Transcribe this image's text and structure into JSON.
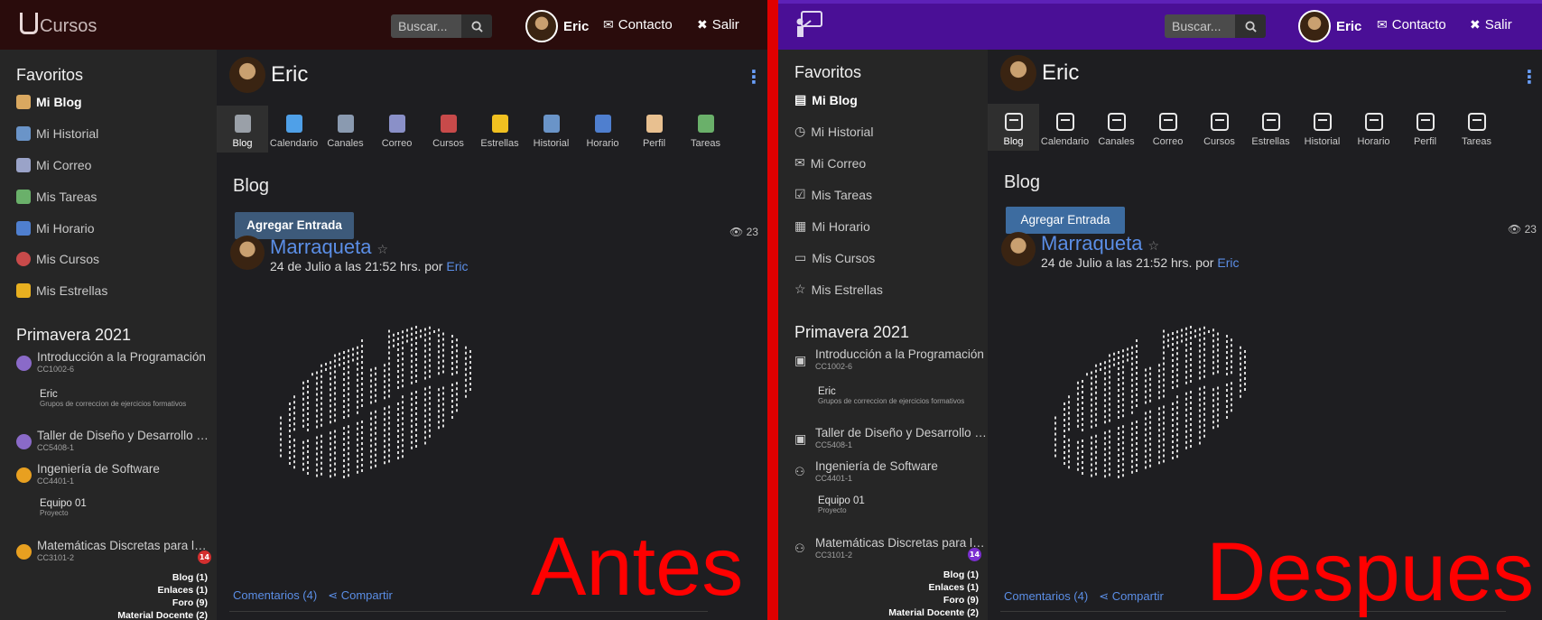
{
  "before": {
    "logo_text": "Cursos",
    "search_placeholder": "Buscar...",
    "user": "Eric",
    "contact": "Contacto",
    "logout": "Salir",
    "favorites_title": "Favoritos",
    "favorites": [
      "Mi Blog",
      "Mi Historial",
      "Mi Correo",
      "Mis Tareas",
      "Mi Horario",
      "Mis Cursos",
      "Mis Estrellas"
    ],
    "semester": "Primavera 2021",
    "courses": [
      {
        "name": "Introducción a la Programación",
        "code": "CC1002-6"
      },
      {
        "name": "Taller de Diseño y Desarrollo de Interfaces",
        "code": "CC5408-1"
      },
      {
        "name": "Ingeniería de Software",
        "code": "CC4401-1"
      },
      {
        "name": "Matemáticas Discretas para la Computación",
        "code": "CC3101-2"
      }
    ],
    "group1": {
      "name": "Eric",
      "desc": "Grupos de correccion de ejercicios formativos"
    },
    "group2": {
      "name": "Equipo 01",
      "desc": "Proyecto"
    },
    "badge": "14",
    "sublinks": [
      "Blog (1)",
      "Enlaces (1)",
      "Foro (9)",
      "Material Docente (2)"
    ],
    "page_title": "Eric",
    "tabs": [
      "Blog",
      "Calendario",
      "Canales",
      "Correo",
      "Cursos",
      "Estrellas",
      "Historial",
      "Horario",
      "Perfil",
      "Tareas"
    ],
    "section": "Blog",
    "add_button": "Agregar Entrada",
    "views": "23",
    "post_title": "Marraqueta",
    "post_meta": "24 de Julio a las 21:52 hrs. por",
    "post_author": "Eric",
    "comments": "Comentarios (4)",
    "share": "Compartir",
    "label": "Antes"
  },
  "after": {
    "search_placeholder": "Buscar...",
    "user": "Eric",
    "contact": "Contacto",
    "logout": "Salir",
    "favorites_title": "Favoritos",
    "favorites": [
      "Mi Blog",
      "Mi Historial",
      "Mi Correo",
      "Mis Tareas",
      "Mi Horario",
      "Mis Cursos",
      "Mis Estrellas"
    ],
    "semester": "Primavera 2021",
    "courses": [
      {
        "name": "Introducción a la Programación",
        "code": "CC1002-6"
      },
      {
        "name": "Taller de Diseño y Desarrollo de Interfaces",
        "code": "CC5408-1"
      },
      {
        "name": "Ingeniería de Software",
        "code": "CC4401-1"
      },
      {
        "name": "Matemáticas Discretas para la Computación",
        "code": "CC3101-2"
      }
    ],
    "group1": {
      "name": "Eric",
      "desc": "Grupos de correccion de ejercicios formativos"
    },
    "group2": {
      "name": "Equipo 01",
      "desc": "Proyecto"
    },
    "badge": "14",
    "sublinks": [
      "Blog (1)",
      "Enlaces (1)",
      "Foro (9)",
      "Material Docente (2)"
    ],
    "page_title": "Eric",
    "tabs": [
      "Blog",
      "Calendario",
      "Canales",
      "Correo",
      "Cursos",
      "Estrellas",
      "Historial",
      "Horario",
      "Perfil",
      "Tareas"
    ],
    "section": "Blog",
    "add_button": "Agregar Entrada",
    "views": "23",
    "post_title": "Marraqueta",
    "post_meta": "24 de Julio a las 21:52 hrs. por",
    "post_author": "Eric",
    "comments": "Comentarios (4)",
    "share": "Compartir",
    "label": "Despues"
  },
  "colors": {
    "divider": "#e00000",
    "before_topbar": "#2a0c0c",
    "after_topbar": "#4a0f96",
    "link": "#5b8ee6"
  }
}
